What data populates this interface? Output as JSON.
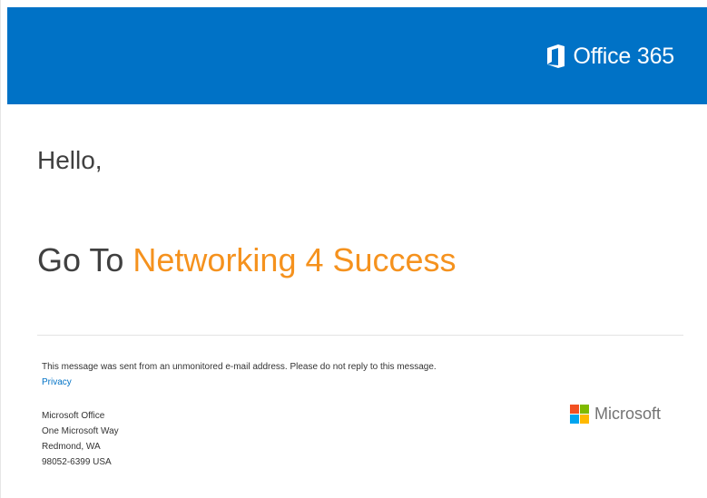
{
  "header": {
    "brand_name": "Office 365",
    "brand_icon": "office-logo-icon",
    "background_color": "#0072c6"
  },
  "body": {
    "greeting": "Hello,",
    "headline_prefix": "Go To ",
    "headline_link": "Networking 4 Success",
    "link_color": "#f5921e"
  },
  "footer": {
    "notice": "This message was sent from an unmonitored e-mail address. Please do not reply to this message.",
    "privacy_label": "Privacy",
    "address": [
      "Microsoft Office",
      "One Microsoft Way",
      "Redmond, WA",
      "98052-6399 USA"
    ],
    "company_logo": {
      "icon": "microsoft-logo-icon",
      "text": "Microsoft",
      "colors": [
        "#f25022",
        "#7fba00",
        "#00a4ef",
        "#ffb900"
      ]
    }
  }
}
